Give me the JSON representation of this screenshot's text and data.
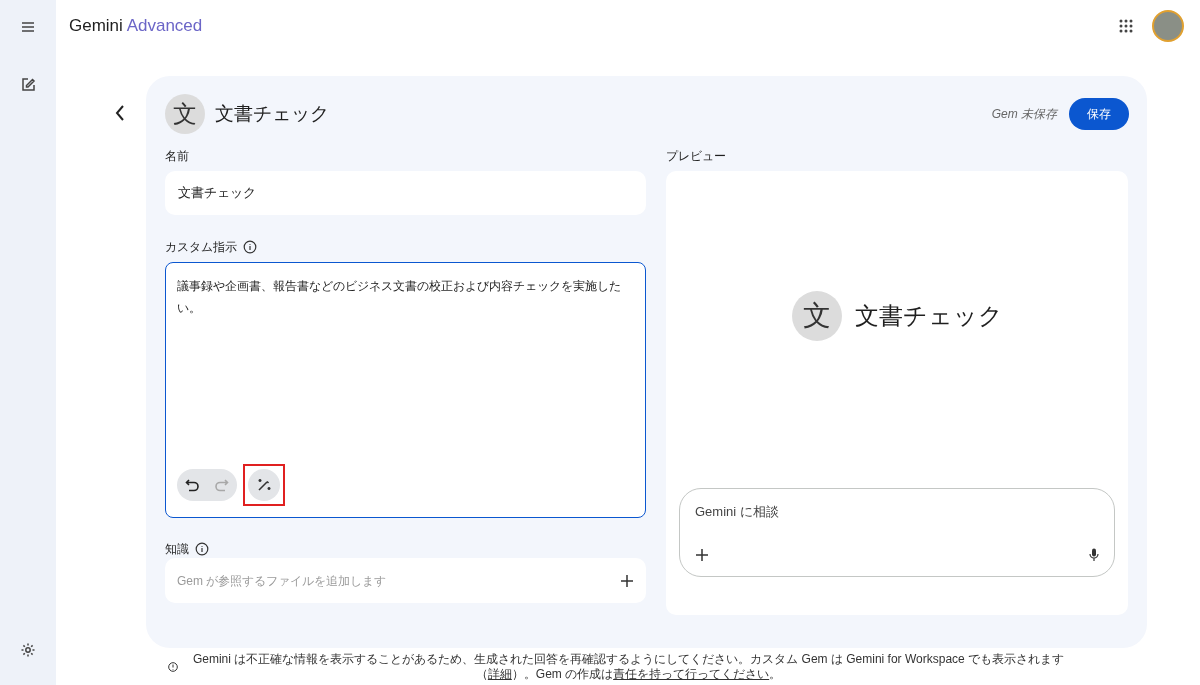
{
  "header": {
    "brand": "Gemini",
    "brand_tier": "Advanced"
  },
  "gem": {
    "avatar_letter": "文",
    "title": "文書チェック",
    "save_status": "Gem 未保存",
    "save_button": "保存"
  },
  "form": {
    "name_label": "名前",
    "name_value": "文書チェック",
    "instructions_label": "カスタム指示",
    "instructions_value": "議事録や企画書、報告書などのビジネス文書の校正および内容チェックを実施したい。",
    "instructions_focused": true,
    "undo_disabled": false,
    "redo_disabled": true,
    "magic_button_highlighted": true,
    "knowledge_label": "知識",
    "knowledge_placeholder": "Gem が参照するファイルを追加します"
  },
  "preview": {
    "label": "プレビュー",
    "avatar_letter": "文",
    "title": "文書チェック",
    "chat_placeholder": "Gemini に相談"
  },
  "footer": {
    "parts": [
      {
        "kind": "text",
        "text": "Gemini は不正確な情報を表示することがあるため、生成された回答を再確認するようにしてください。カスタム Gem は Gemini for Workspace でも表示されます（"
      },
      {
        "kind": "link",
        "text": "詳細"
      },
      {
        "kind": "text",
        "text": "）。Gem の作成は"
      },
      {
        "kind": "link",
        "text": "責任を持って行ってください"
      },
      {
        "kind": "text",
        "text": "。"
      }
    ]
  }
}
